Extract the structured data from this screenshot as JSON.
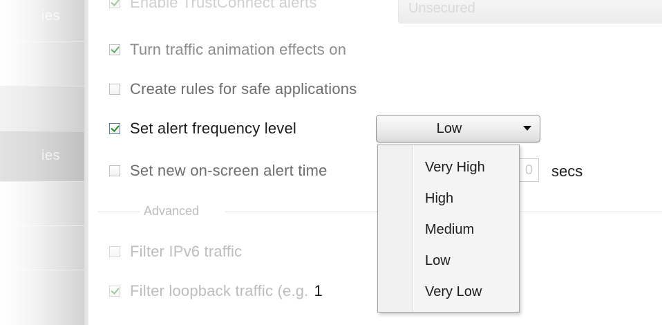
{
  "sidebar": {
    "top_label": "ies",
    "mid_label": "ies"
  },
  "options": {
    "truste_alerts": {
      "label": "Enable TrustConnect alerts",
      "checked": true,
      "select_value": "Unsecured"
    },
    "traffic_animation": {
      "label": "Turn traffic animation effects on",
      "checked": true
    },
    "safe_app_rules": {
      "label": "Create rules for safe applications",
      "checked": false
    },
    "alert_frequency": {
      "label": "Set alert frequency level",
      "checked": true
    },
    "alert_timeout": {
      "label": "Set new on-screen alert time",
      "checked": false,
      "value": "0",
      "unit": "secs"
    }
  },
  "frequency_select": {
    "selected": "Low",
    "options": [
      "Very High",
      "High",
      "Medium",
      "Low",
      "Very Low"
    ]
  },
  "advanced": {
    "section_label": "Advanced",
    "filter_ipv6": {
      "label": "Filter IPv6 traffic",
      "checked": false
    },
    "filter_loopback": {
      "label": "Filter loopback traffic (e.g.",
      "visible_extra": "1",
      "checked": true
    }
  }
}
